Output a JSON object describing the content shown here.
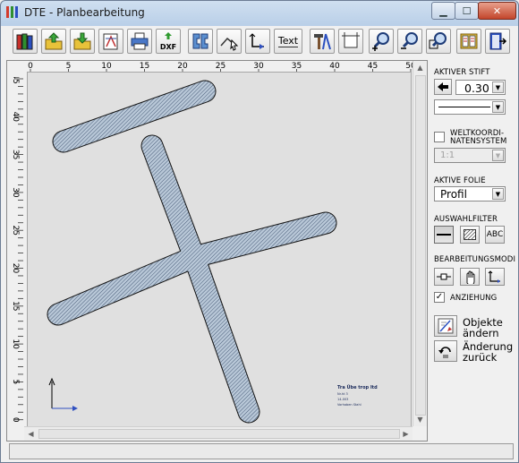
{
  "window": {
    "title": "DTE - Planbearbeitung",
    "app_icon_colors": [
      "#d33a2c",
      "#2f8f2f",
      "#2a4fc0"
    ],
    "controls": [
      "minimize-icon",
      "maximize-icon",
      "close-icon"
    ]
  },
  "toolbar": {
    "buttons": [
      {
        "name": "open-library-button",
        "icon": "books-icon"
      },
      {
        "name": "export-button",
        "icon": "folder-up-icon"
      },
      {
        "name": "import-button",
        "icon": "folder-down-icon"
      },
      {
        "name": "plan-settings-button",
        "icon": "sheet-compass-icon"
      },
      {
        "name": "print-button",
        "icon": "printer-icon"
      },
      {
        "name": "dxf-export-button",
        "icon": "dxf-icon",
        "label": "DXF"
      },
      {
        "name": "profile-button",
        "icon": "profile-icon"
      },
      {
        "name": "draw-line-button",
        "icon": "polyline-cursor-icon"
      },
      {
        "name": "dimension-button",
        "icon": "axis-dimension-icon"
      },
      {
        "name": "text-button",
        "icon": "text-icon",
        "label": "Text"
      },
      {
        "name": "tools-button",
        "icon": "hammer-compass-icon"
      },
      {
        "name": "frame-button",
        "icon": "frame-icon"
      },
      {
        "name": "zoom-in-button",
        "icon": "zoom-in-icon"
      },
      {
        "name": "zoom-out-button",
        "icon": "zoom-out-icon"
      },
      {
        "name": "zoom-fit-button",
        "icon": "zoom-fit-icon"
      },
      {
        "name": "catalog-button",
        "icon": "catalog-icon"
      },
      {
        "name": "exit-button",
        "icon": "exit-door-icon"
      }
    ]
  },
  "rulers": {
    "horizontal": [
      "0",
      "5",
      "10",
      "15",
      "20",
      "25",
      "30",
      "35",
      "40",
      "45",
      "50"
    ],
    "vertical": [
      "45",
      "40",
      "35",
      "30",
      "25",
      "20",
      "15",
      "10",
      "5",
      "0"
    ]
  },
  "drawing": {
    "shape": "I-beam cross-section, rotated",
    "fill_color": "#b9c8d8",
    "hatch_color": "#3a4f6c",
    "titleblock_lines": [
      "Tra Übe trop Itd",
      "Nr.ht 3",
      "14-003",
      "Vorhaben Stahl"
    ]
  },
  "panel": {
    "aktiver_stift": {
      "label": "AKTIVER STIFT",
      "pen_width": "0.30",
      "arrow_icon": "arrow-left-icon"
    },
    "weltkoordinaten": {
      "label_line1": "WELTKOORDI-",
      "label_line2": "NATENSYSTEM",
      "checked": false,
      "scale": "1:1"
    },
    "aktive_folie": {
      "label": "AKTIVE FOLIE",
      "value": "Profil"
    },
    "auswahlfilter": {
      "label": "AUSWAHLFILTER",
      "buttons": [
        {
          "name": "filter-line-button",
          "icon": "line-icon",
          "pressed": true
        },
        {
          "name": "filter-hatch-button",
          "icon": "hatch-icon",
          "pressed": false
        },
        {
          "name": "filter-text-button",
          "icon": "abc-icon",
          "label": "ABC",
          "pressed": false
        }
      ]
    },
    "bearbeitungsmodi": {
      "label": "BEARBEITUNGSMODI",
      "buttons": [
        {
          "name": "mode-snap-button",
          "icon": "snap-point-icon"
        },
        {
          "name": "mode-pan-button",
          "icon": "hand-icon"
        },
        {
          "name": "mode-axis-button",
          "icon": "axis-icon"
        }
      ]
    },
    "anziehung": {
      "label": "ANZIEHUNG",
      "checked": true
    },
    "objekte_aendern": {
      "line1": "Objekte",
      "line2": "ändern"
    },
    "aenderung_zurueck": {
      "line1": "Änderung",
      "line2": "zurück"
    }
  }
}
